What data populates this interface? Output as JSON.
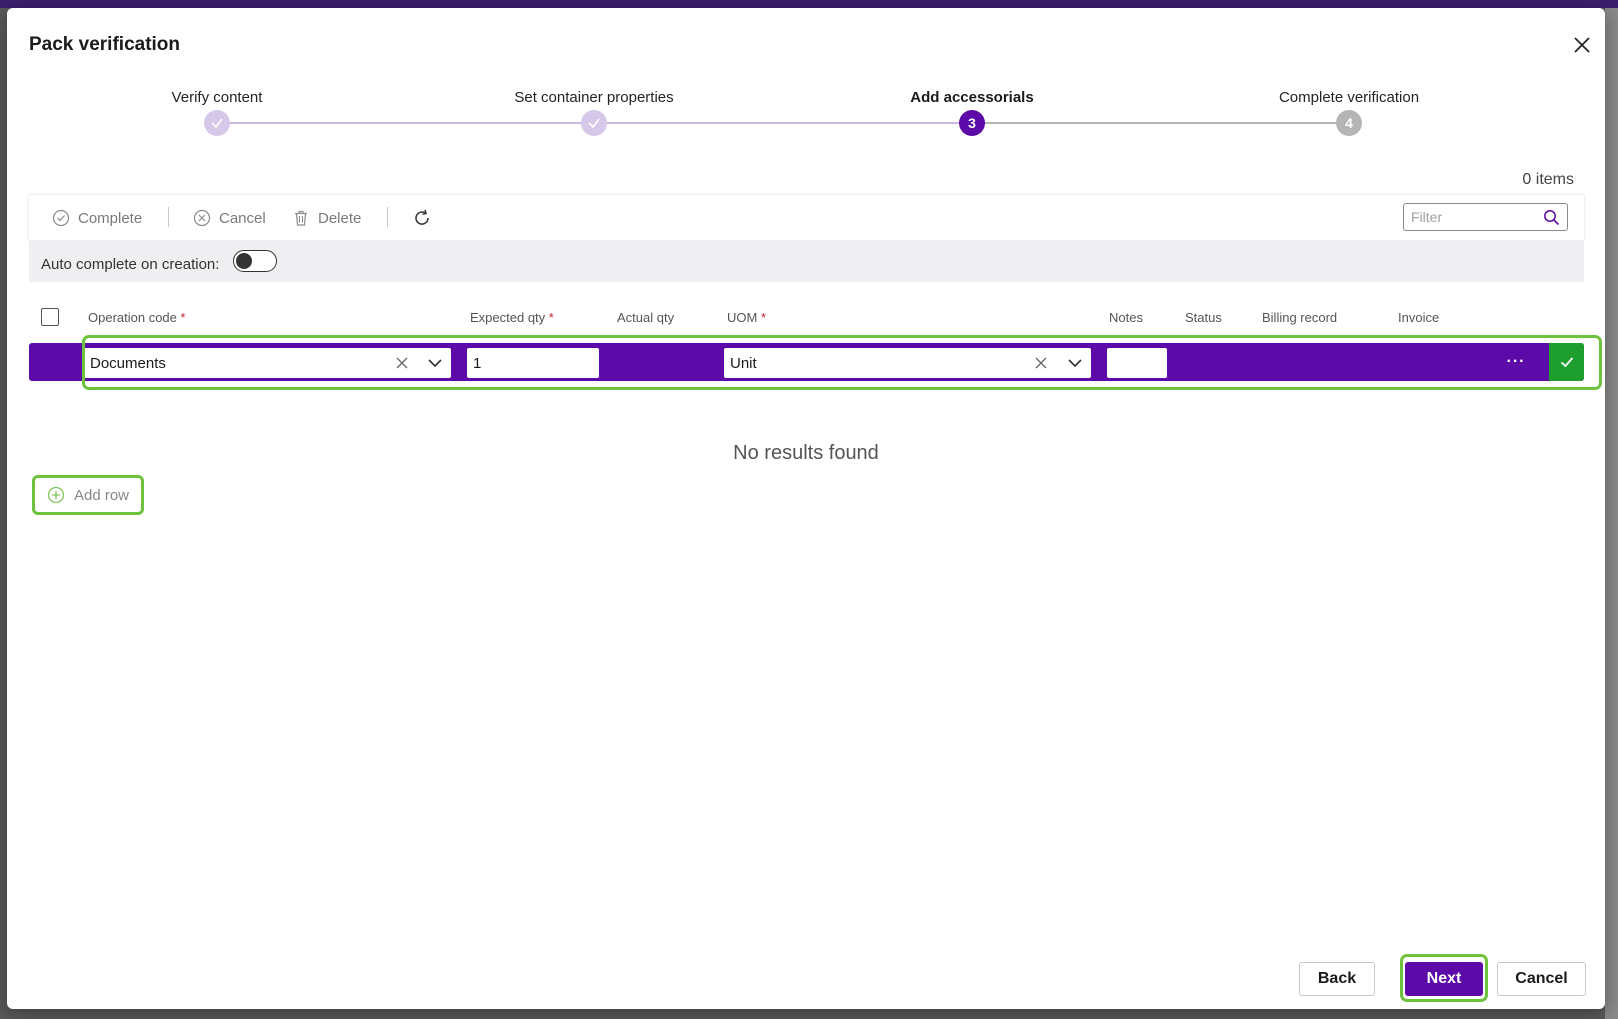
{
  "dialog": {
    "title": "Pack verification"
  },
  "stepper": {
    "steps": [
      {
        "label": "Verify content",
        "state": "done",
        "badge": ""
      },
      {
        "label": "Set container properties",
        "state": "done",
        "badge": ""
      },
      {
        "label": "Add accessorials",
        "state": "current",
        "badge": "3"
      },
      {
        "label": "Complete verification",
        "state": "todo",
        "badge": "4"
      }
    ]
  },
  "grid": {
    "items_count": "0 items",
    "toolbar": {
      "complete_label": "Complete",
      "cancel_label": "Cancel",
      "delete_label": "Delete",
      "filter_placeholder": "Filter"
    },
    "auto_complete_label": "Auto complete on creation:",
    "auto_complete_on": false,
    "columns": [
      {
        "label": "Operation code",
        "required": "*"
      },
      {
        "label": "Expected qty",
        "required": "*"
      },
      {
        "label": "Actual qty",
        "required": ""
      },
      {
        "label": "UOM",
        "required": "*"
      },
      {
        "label": "Notes",
        "required": ""
      },
      {
        "label": "Status",
        "required": ""
      },
      {
        "label": "Billing record",
        "required": ""
      },
      {
        "label": "Invoice",
        "required": ""
      }
    ],
    "edit_row": {
      "operation_code": "Documents",
      "expected_qty": "1",
      "uom": "Unit",
      "notes": "",
      "more_label": "···"
    },
    "empty_message": "No results found",
    "add_row_label": "Add row"
  },
  "footer": {
    "back_label": "Back",
    "next_label": "Next",
    "cancel_label": "Cancel"
  },
  "colors": {
    "accent": "#5c0aa8",
    "highlight": "#6ec23e",
    "confirm": "#1e9e2e"
  }
}
